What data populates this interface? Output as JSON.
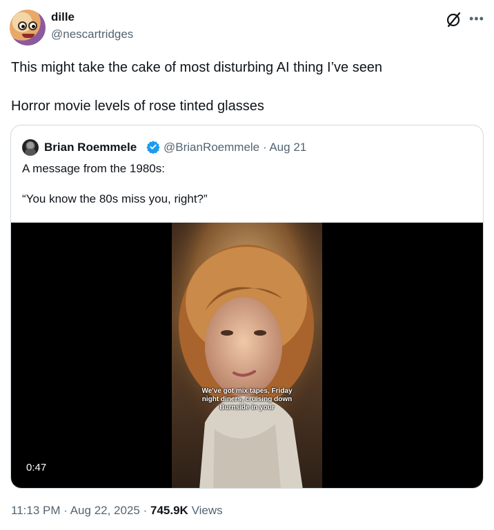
{
  "author": {
    "name": "dille",
    "handle": "@nescartridges"
  },
  "tweet": {
    "line1": "This might take the cake of most disturbing AI thing I’ve seen",
    "line2": "Horror movie levels of rose tinted glasses"
  },
  "quote": {
    "name": "Brian Roemmele",
    "handle": "@BrianRoemmele",
    "separator": "·",
    "date": "Aug 21",
    "text1": "A message from the 1980s:",
    "text2": "“You know the 80s miss you, right?”",
    "video": {
      "caption": "We've got mix tapes, Friday night diners, cruising down Burnside in your",
      "duration": "0:47"
    }
  },
  "footer": {
    "time": "11:13 PM",
    "sep1": "·",
    "date": "Aug 22, 2025",
    "sep2": "·",
    "views_count": "745.9K",
    "views_label": "Views"
  },
  "icons": {
    "more": "more-icon",
    "grok": "grok-icon",
    "verified": "verified-badge-icon"
  },
  "colors": {
    "text": "#0f1419",
    "secondary": "#536471",
    "verified": "#1d9bf0",
    "border": "#cfd9de"
  }
}
